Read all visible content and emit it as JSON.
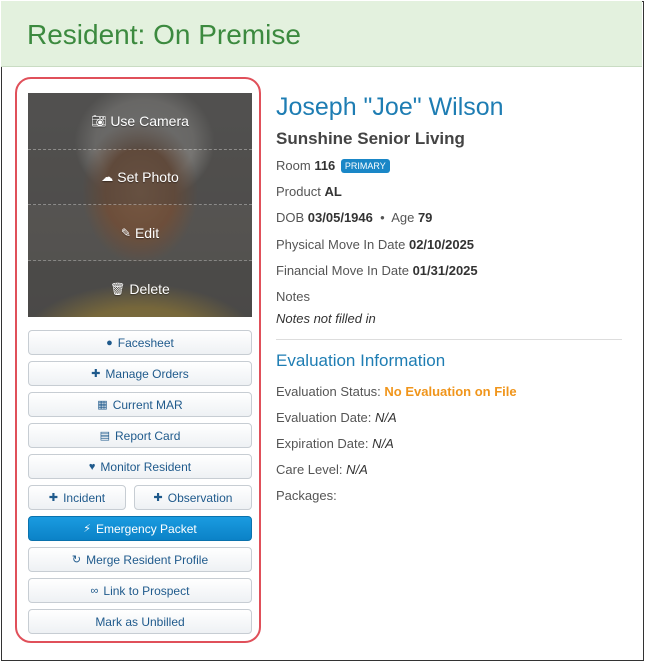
{
  "header": {
    "title": "Resident: On Premise"
  },
  "photo_menu": {
    "use_camera": "Use Camera",
    "set_photo": "Set Photo",
    "edit": "Edit",
    "delete": "Delete"
  },
  "actions": {
    "facesheet": "Facesheet",
    "manage_orders": "Manage Orders",
    "current_mar": "Current MAR",
    "report_card": "Report Card",
    "monitor_resident": "Monitor Resident",
    "incident": "Incident",
    "observation": "Observation",
    "emergency_packet": "Emergency Packet",
    "merge_profile": "Merge Resident Profile",
    "link_prospect": "Link to Prospect",
    "mark_unbilled": "Mark as Unbilled"
  },
  "resident": {
    "name": "Joseph \"Joe\" Wilson",
    "facility": "Sunshine Senior Living",
    "room_label": "Room",
    "room": "116",
    "room_badge": "PRIMARY",
    "product_label": "Product",
    "product": "AL",
    "dob_label": "DOB",
    "dob": "03/05/1946",
    "age_label": "Age",
    "age": "79",
    "physical_move_label": "Physical Move In Date",
    "physical_move": "02/10/2025",
    "financial_move_label": "Financial Move In Date",
    "financial_move": "01/31/2025",
    "notes_label": "Notes",
    "notes_value": "Notes not filled in"
  },
  "evaluation": {
    "title": "Evaluation Information",
    "status_label": "Evaluation Status:",
    "status_value": "No Evaluation on File",
    "date_label": "Evaluation Date:",
    "date_value": "N/A",
    "expiration_label": "Expiration Date:",
    "expiration_value": "N/A",
    "care_level_label": "Care Level:",
    "care_level_value": "N/A",
    "packages_label": "Packages:"
  },
  "colors": {
    "header_bg": "#e3f1de",
    "header_text": "#3c8a3f",
    "accent_blue": "#1e7db3",
    "primary_button": "#0b82c7",
    "warning_orange": "#f0951b",
    "highlight_border": "#e0505a"
  }
}
